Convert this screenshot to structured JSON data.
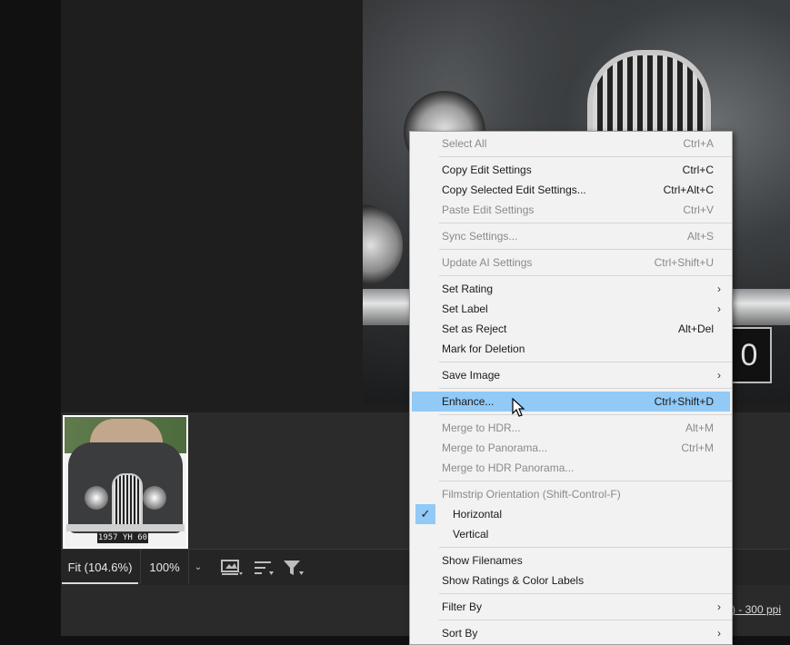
{
  "toolbar": {
    "zoom_fit_label": "Fit (104.6%)",
    "zoom_100_label": "100%",
    "zoom_dropdown_glyph": "⌄",
    "icons": [
      "sort-by-rating-icon",
      "sort-order-icon",
      "filter-icon"
    ]
  },
  "filmstrip": {
    "thumbnail_plate_text": "1957 YH 60"
  },
  "photo": {
    "plate_char": "0"
  },
  "status": {
    "resolution_text": "?) - 300 ppi"
  },
  "context_menu": {
    "highlight_color": "#91c9f7",
    "items": [
      {
        "label": "Select All",
        "shortcut": "Ctrl+A",
        "enabled": false
      },
      {
        "label": "Copy Edit Settings",
        "shortcut": "Ctrl+C",
        "enabled": true
      },
      {
        "label": "Copy Selected Edit Settings...",
        "shortcut": "Ctrl+Alt+C",
        "enabled": true
      },
      {
        "label": "Paste Edit Settings",
        "shortcut": "Ctrl+V",
        "enabled": false
      },
      {
        "label": "Sync Settings...",
        "shortcut": "Alt+S",
        "enabled": false
      },
      {
        "label": "Update AI Settings",
        "shortcut": "Ctrl+Shift+U",
        "enabled": false
      },
      {
        "label": "Set Rating",
        "shortcut": "",
        "enabled": true,
        "submenu": true
      },
      {
        "label": "Set Label",
        "shortcut": "",
        "enabled": true,
        "submenu": true
      },
      {
        "label": "Set as Reject",
        "shortcut": "Alt+Del",
        "enabled": true
      },
      {
        "label": "Mark for Deletion",
        "shortcut": "",
        "enabled": true
      },
      {
        "label": "Save Image",
        "shortcut": "",
        "enabled": true,
        "submenu": true
      },
      {
        "label": "Enhance...",
        "shortcut": "Ctrl+Shift+D",
        "enabled": true,
        "highlighted": true
      },
      {
        "label": "Merge to HDR...",
        "shortcut": "Alt+M",
        "enabled": false
      },
      {
        "label": "Merge to Panorama...",
        "shortcut": "Ctrl+M",
        "enabled": false
      },
      {
        "label": "Merge to HDR Panorama...",
        "shortcut": "",
        "enabled": false
      },
      {
        "label": "Filmstrip Orientation (Shift-Control-F)",
        "shortcut": "",
        "enabled": false
      },
      {
        "label": "Horizontal",
        "shortcut": "",
        "enabled": true,
        "checked": true
      },
      {
        "label": "Vertical",
        "shortcut": "",
        "enabled": true
      },
      {
        "label": "Show Filenames",
        "shortcut": "",
        "enabled": true
      },
      {
        "label": "Show Ratings & Color Labels",
        "shortcut": "",
        "enabled": true
      },
      {
        "label": "Filter By",
        "shortcut": "",
        "enabled": true,
        "submenu": true
      },
      {
        "label": "Sort By",
        "shortcut": "",
        "enabled": true,
        "submenu": true
      }
    ],
    "submenu_arrow": "›",
    "check_glyph": "✓"
  }
}
